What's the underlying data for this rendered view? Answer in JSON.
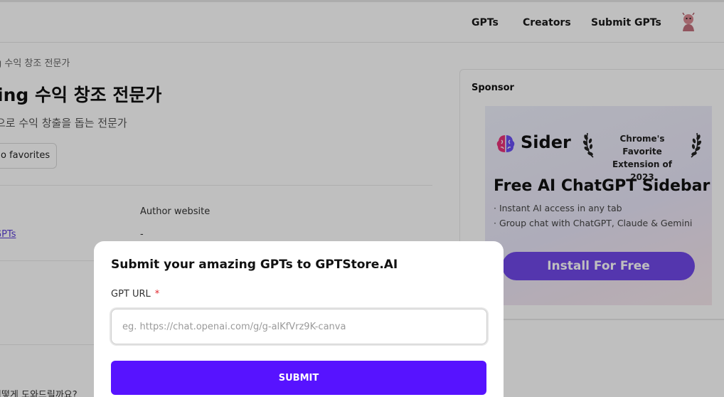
{
  "header": {
    "nav": [
      {
        "label": "GPTs"
      },
      {
        "label": "Creators"
      },
      {
        "label": "Submit GPTs"
      }
    ]
  },
  "detail": {
    "breadcrumb": "g 수익 창조 전문가",
    "title": "ing 수익 창조 전문가",
    "description": "으로 수익 창출을 돕는 전문가",
    "favorites_label": "o favorites",
    "author_website_label": "Author website",
    "author_website_value": "-",
    "gpts_link": "GPTs",
    "bottom_question": "어떻게 도와드릴까요?"
  },
  "sidebar": {
    "sponsor_label": "Sponsor",
    "ad": {
      "brand": "Sider",
      "award_line1": "Chrome's Favorite",
      "award_line2": "Extension of 2023",
      "headline": "Free AI ChatGPT Sidebar",
      "bullets": [
        "· Instant AI access in any tab",
        "· Group chat with ChatGPT, Claude & Gemini"
      ],
      "cta": "Install For Free",
      "cta_color": "#7048e8"
    }
  },
  "modal": {
    "title": "Submit your amazing GPTs to GPTStore.AI",
    "field_label": "GPT URL",
    "required_mark": "*",
    "url_value": "",
    "url_placeholder": "eg. https://chat.openai.com/g/g-alKfVrz9K-canva",
    "submit_label": "SUBMIT",
    "submit_color": "#5713ff"
  }
}
